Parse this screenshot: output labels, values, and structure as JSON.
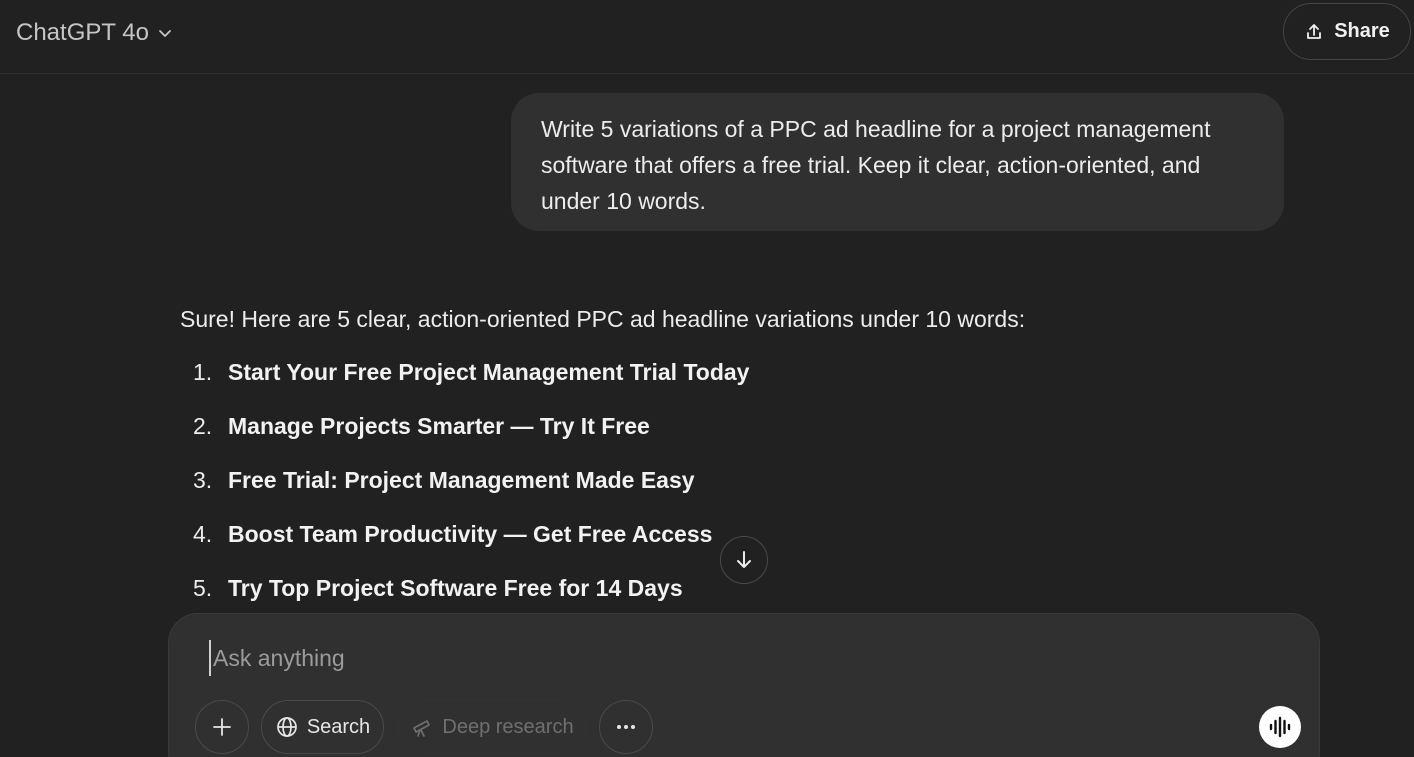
{
  "header": {
    "model_name": "ChatGPT 4o",
    "share_label": "Share"
  },
  "conversation": {
    "user_message": "Write 5 variations of a PPC ad headline for a project management software that offers a free trial. Keep it clear, action-oriented, and under 10 words.",
    "assistant_intro": "Sure! Here are 5 clear, action-oriented PPC ad headline variations under 10 words:",
    "assistant_items": [
      {
        "num": "1.",
        "text": "Start Your Free Project Management Trial Today"
      },
      {
        "num": "2.",
        "text": "Manage Projects Smarter — Try It Free"
      },
      {
        "num": "3.",
        "text": "Free Trial: Project Management Made Easy"
      },
      {
        "num": "4.",
        "text": "Boost Team Productivity — Get Free Access"
      },
      {
        "num": "5.",
        "text": "Try Top Project Software Free for 14 Days"
      }
    ]
  },
  "composer": {
    "placeholder": "Ask anything",
    "search_label": "Search",
    "deep_research_label": "Deep research"
  },
  "icons": {
    "model_chevron": "chevron-down-icon",
    "share": "share-icon",
    "scroll_down": "arrow-down-icon",
    "add": "plus-icon",
    "search": "globe-icon",
    "deep_research": "telescope-icon",
    "more": "ellipsis-icon",
    "voice": "voice-waveform-icon"
  },
  "colors": {
    "background": "#212121",
    "bubble": "#303030",
    "text": "#ececec"
  }
}
